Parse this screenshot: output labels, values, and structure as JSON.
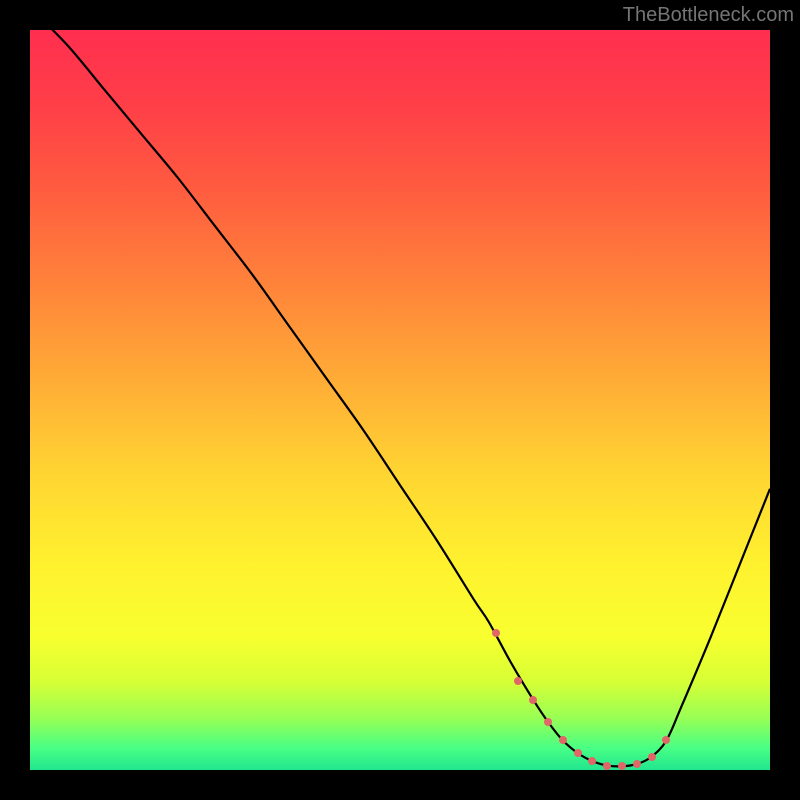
{
  "watermark": "TheBottleneck.com",
  "chart_data": {
    "type": "line",
    "title": "",
    "xlabel": "",
    "ylabel": "",
    "xlim": [
      0,
      100
    ],
    "ylim": [
      0,
      100
    ],
    "series": [
      {
        "name": "bottleneck-curve",
        "x": [
          0,
          5,
          10,
          15,
          20,
          25,
          30,
          35,
          40,
          45,
          50,
          55,
          60,
          62,
          65,
          68,
          70,
          72,
          74,
          76,
          78,
          80,
          82,
          84,
          86,
          88,
          92,
          96,
          100
        ],
        "y": [
          103,
          98,
          92,
          86,
          80,
          73.5,
          67,
          60,
          53,
          46,
          38.5,
          31,
          23,
          20,
          14.5,
          9.5,
          6.5,
          4,
          2.3,
          1.2,
          0.6,
          0.5,
          0.8,
          1.8,
          4,
          8.5,
          18,
          28,
          38
        ]
      }
    ],
    "markers": {
      "name": "optimal-range",
      "x": [
        63,
        66,
        68,
        70,
        72,
        74,
        76,
        78,
        80,
        82,
        84,
        86
      ],
      "y": [
        18.5,
        12,
        9.5,
        6.5,
        4,
        2.3,
        1.2,
        0.6,
        0.5,
        0.8,
        1.8,
        4
      ]
    },
    "gradient": {
      "stops": [
        {
          "offset": 0.0,
          "color": "#ff2f4f"
        },
        {
          "offset": 0.1,
          "color": "#ff3e48"
        },
        {
          "offset": 0.22,
          "color": "#ff5d3f"
        },
        {
          "offset": 0.35,
          "color": "#ff853a"
        },
        {
          "offset": 0.48,
          "color": "#ffae36"
        },
        {
          "offset": 0.6,
          "color": "#ffd532"
        },
        {
          "offset": 0.72,
          "color": "#fff12f"
        },
        {
          "offset": 0.82,
          "color": "#f8ff2f"
        },
        {
          "offset": 0.88,
          "color": "#d7ff35"
        },
        {
          "offset": 0.93,
          "color": "#98ff55"
        },
        {
          "offset": 0.97,
          "color": "#49ff84"
        },
        {
          "offset": 1.0,
          "color": "#21e690"
        }
      ]
    },
    "annotations": [],
    "legend": false,
    "grid": false
  }
}
